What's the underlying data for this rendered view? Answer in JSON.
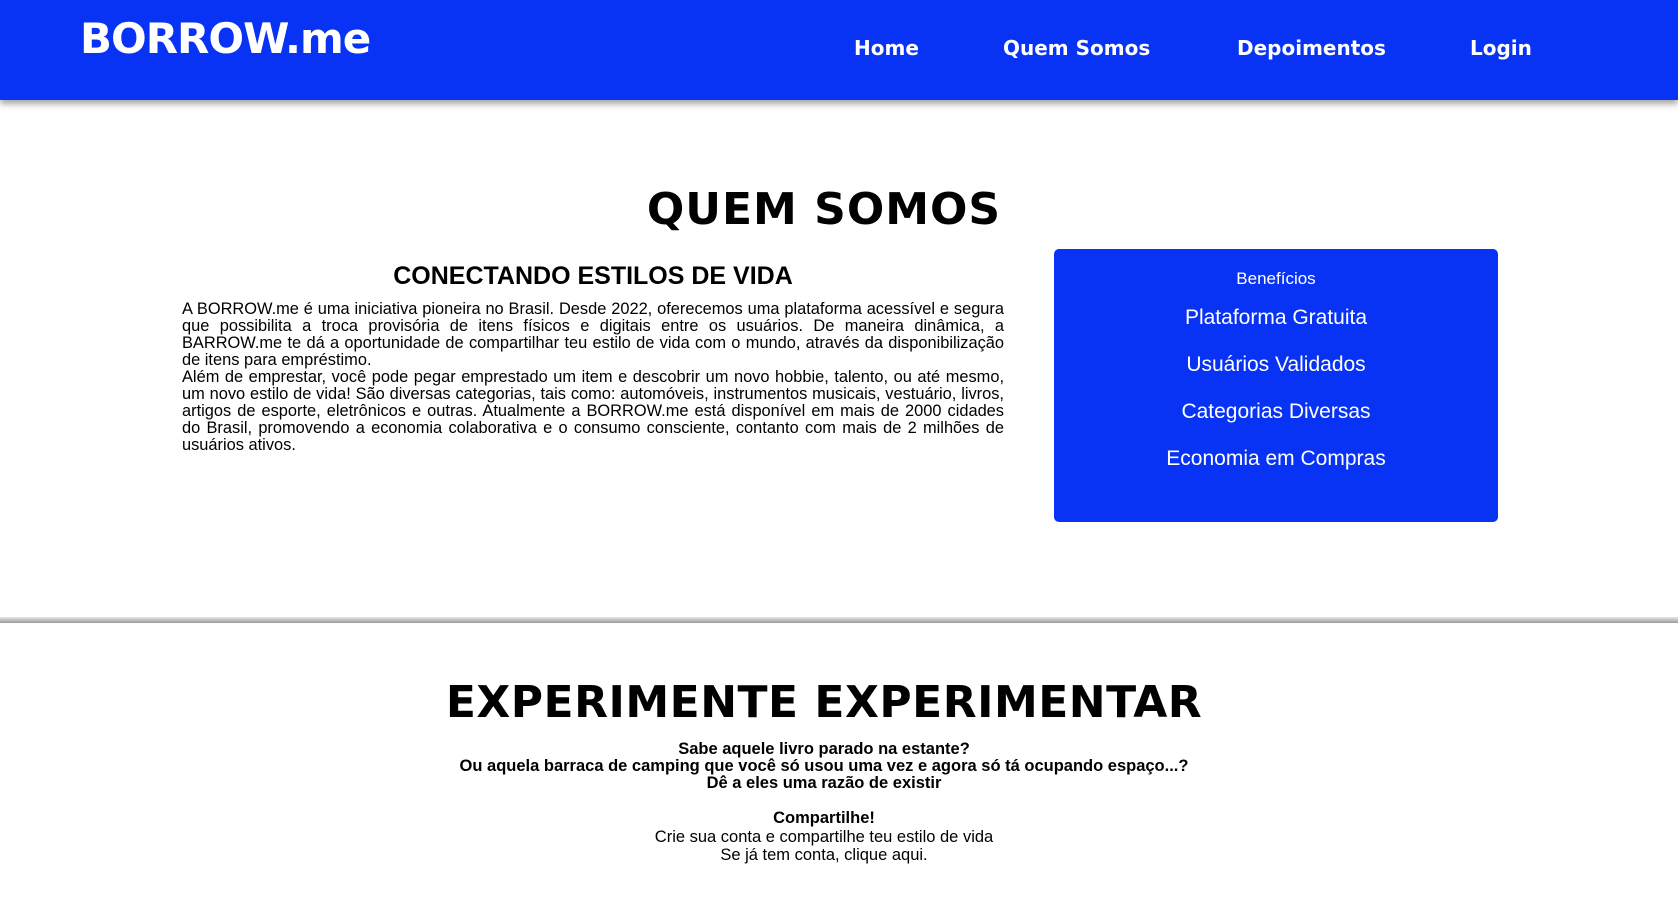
{
  "brand": {
    "logo_text": "BORROW.me",
    "primary_color": "#0833f5"
  },
  "nav": {
    "items": [
      "Home",
      "Quem Somos",
      "Depoimentos",
      "Login"
    ]
  },
  "about": {
    "title": "QUEM SOMOS",
    "subtitle": "CONECTANDO ESTILOS DE VIDA",
    "paragraph_1": "A BORROW.me é uma iniciativa pioneira no Brasil. Desde 2022, oferecemos uma plataforma acessível e segura que possibilita a troca provisória de itens físicos e digitais entre os usuários. De maneira dinâmica, a BARROW.me te dá a oportunidade de compartilhar teu estilo de vida com o mundo, através da disponibilização de itens para empréstimo.",
    "paragraph_2": "Além de emprestar, você pode pegar emprestado um item e descobrir um novo hobbie, talento, ou até mesmo, um novo estilo de vida! São diversas categorias, tais como: automóveis, instrumentos musicais, vestuário, livros, artigos de esporte, eletrônicos e outras. Atualmente a BORROW.me está disponível em mais de 2000 cidades do Brasil, promovendo a economia colaborativa e o consumo consciente, contanto com mais de 2 milhões de usuários ativos."
  },
  "benefits": {
    "heading": "Benefícios",
    "items": [
      "Plataforma Gratuita",
      "Usuários Validados",
      "Categorias Diversas",
      "Economia em Compras"
    ]
  },
  "experiment": {
    "title": "EXPERIMENTE EXPERIMENTAR",
    "line_1": "Sabe aquele livro parado na estante?",
    "line_2": "Ou aquela barraca de camping que você só usou uma vez e agora só tá ocupando espaço...?",
    "line_3": "Dê a eles uma razão de existir",
    "cta_title": "Compartilhe!",
    "cta_line_1": "Crie sua conta e compartilhe teu estilo de vida",
    "cta_line_2": "Se já tem conta, clique aqui."
  }
}
